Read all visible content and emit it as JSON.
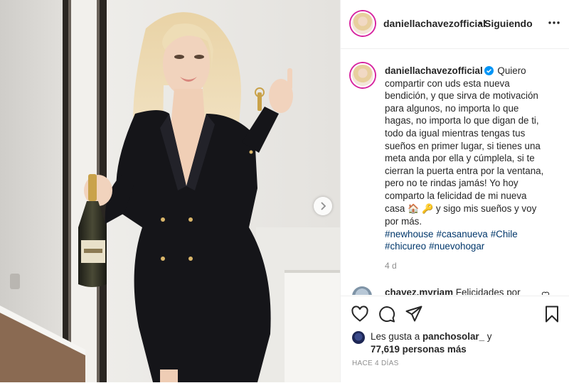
{
  "post": {
    "username": "daniellachavezofficial",
    "dot": "•",
    "follow_label": "Siguiendo",
    "more_icon": "more-horizontal-icon"
  },
  "caption": {
    "username": "daniellachavezofficial",
    "text": "Quiero compartir con uds esta nueva bendición, y que sirva de motivación para algunos, no importa lo que hagas, no importa lo que digan de ti, todo da igual mientras tengas tus sueños en primer lugar, si tienes una meta anda por ella y cúmplela, si te cierran la puerta entra por la ventana, pero no te rindas jamás! Yo hoy comparto la felicidad de mi nueva casa",
    "emoji_house": "🏠",
    "emoji_key": "🔑",
    "text_end": "y sigo mis sueños y voy por más.",
    "hashtags": [
      "#newhouse",
      "#casanueva",
      "#Chile",
      "#chicureo",
      "#nuevohogar"
    ],
    "age": "4 d"
  },
  "comment": {
    "username": "chavez.myriam",
    "text": "Felicidades por"
  },
  "likes": {
    "prefix": "Les gusta a",
    "user": "panchosolar_",
    "connector": "y",
    "count": "77,619 personas más"
  },
  "posted": "HACE 4 DÍAS",
  "colors": {
    "text": "#262626",
    "secondary": "#8e8e8e",
    "hashtag": "#00376b",
    "verified": "#0095f6",
    "border": "#efefef"
  }
}
